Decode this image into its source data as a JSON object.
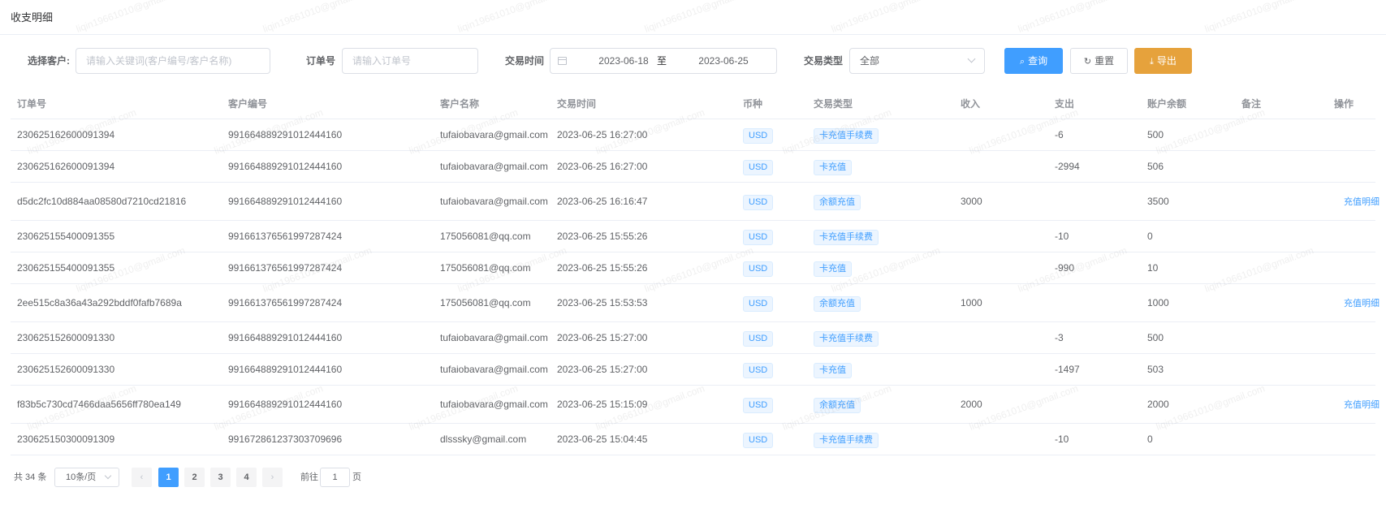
{
  "page": {
    "title": "收支明细"
  },
  "filters": {
    "customer_label": "选择客户:",
    "customer_placeholder": "请输入关键词(客户编号/客户名称)",
    "order_label": "订单号",
    "order_placeholder": "请输入订单号",
    "time_label": "交易时间",
    "date_start": "2023-06-18",
    "date_sep": "至",
    "date_end": "2023-06-25",
    "type_label": "交易类型",
    "type_value": "全部",
    "search_label": "查询",
    "reset_label": "重置",
    "export_label": "导出"
  },
  "table": {
    "columns": [
      "订单号",
      "客户编号",
      "客户名称",
      "交易时间",
      "币种",
      "交易类型",
      "收入",
      "支出",
      "账户余额",
      "备注",
      "操作"
    ],
    "rows": [
      {
        "order": "230625162600091394",
        "cust_no": "991664889291012444160",
        "cust_name": "tufaiobavara@gmail.com",
        "time": "2023-06-25 16:27:00",
        "currency": "USD",
        "type": "卡充值手续费",
        "income": "",
        "expense": "-6",
        "balance": "500",
        "remark": "",
        "op": ""
      },
      {
        "order": "230625162600091394",
        "cust_no": "991664889291012444160",
        "cust_name": "tufaiobavara@gmail.com",
        "time": "2023-06-25 16:27:00",
        "currency": "USD",
        "type": "卡充值",
        "income": "",
        "expense": "-2994",
        "balance": "506",
        "remark": "",
        "op": ""
      },
      {
        "order": "d5dc2fc10d884aa08580d7210cd21816",
        "cust_no": "991664889291012444160",
        "cust_name": "tufaiobavara@gmail.com",
        "time": "2023-06-25 16:16:47",
        "currency": "USD",
        "type": "余额充值",
        "income": "3000",
        "expense": "",
        "balance": "3500",
        "remark": "",
        "op": "充值明细"
      },
      {
        "order": "230625155400091355",
        "cust_no": "991661376561997287424",
        "cust_name": "175056081@qq.com",
        "time": "2023-06-25 15:55:26",
        "currency": "USD",
        "type": "卡充值手续费",
        "income": "",
        "expense": "-10",
        "balance": "0",
        "remark": "",
        "op": ""
      },
      {
        "order": "230625155400091355",
        "cust_no": "991661376561997287424",
        "cust_name": "175056081@qq.com",
        "time": "2023-06-25 15:55:26",
        "currency": "USD",
        "type": "卡充值",
        "income": "",
        "expense": "-990",
        "balance": "10",
        "remark": "",
        "op": ""
      },
      {
        "order": "2ee515c8a36a43a292bddf0fafb7689a",
        "cust_no": "991661376561997287424",
        "cust_name": "175056081@qq.com",
        "time": "2023-06-25 15:53:53",
        "currency": "USD",
        "type": "余额充值",
        "income": "1000",
        "expense": "",
        "balance": "1000",
        "remark": "",
        "op": "充值明细"
      },
      {
        "order": "230625152600091330",
        "cust_no": "991664889291012444160",
        "cust_name": "tufaiobavara@gmail.com",
        "time": "2023-06-25 15:27:00",
        "currency": "USD",
        "type": "卡充值手续费",
        "income": "",
        "expense": "-3",
        "balance": "500",
        "remark": "",
        "op": ""
      },
      {
        "order": "230625152600091330",
        "cust_no": "991664889291012444160",
        "cust_name": "tufaiobavara@gmail.com",
        "time": "2023-06-25 15:27:00",
        "currency": "USD",
        "type": "卡充值",
        "income": "",
        "expense": "-1497",
        "balance": "503",
        "remark": "",
        "op": ""
      },
      {
        "order": "f83b5c730cd7466daa5656ff780ea149",
        "cust_no": "991664889291012444160",
        "cust_name": "tufaiobavara@gmail.com",
        "time": "2023-06-25 15:15:09",
        "currency": "USD",
        "type": "余额充值",
        "income": "2000",
        "expense": "",
        "balance": "2000",
        "remark": "",
        "op": "充值明细"
      },
      {
        "order": "230625150300091309",
        "cust_no": "991672861237303709696",
        "cust_name": "dlsssky@gmail.com",
        "time": "2023-06-25 15:04:45",
        "currency": "USD",
        "type": "卡充值手续费",
        "income": "",
        "expense": "-10",
        "balance": "0",
        "remark": "",
        "op": ""
      }
    ]
  },
  "pagination": {
    "total_label": "共 34 条",
    "page_size": "10条/页",
    "prev_symbol": "‹",
    "next_symbol": "›",
    "pages": [
      "1",
      "2",
      "3",
      "4"
    ],
    "current_page": "1",
    "goto_label": "前往",
    "goto_value": "1",
    "goto_suffix": "页"
  },
  "watermark": {
    "text": "liqin19661010@gmail.com"
  },
  "colors": {
    "primary": "#409eff",
    "warning": "#e6a23c",
    "border": "#ebeef5"
  }
}
